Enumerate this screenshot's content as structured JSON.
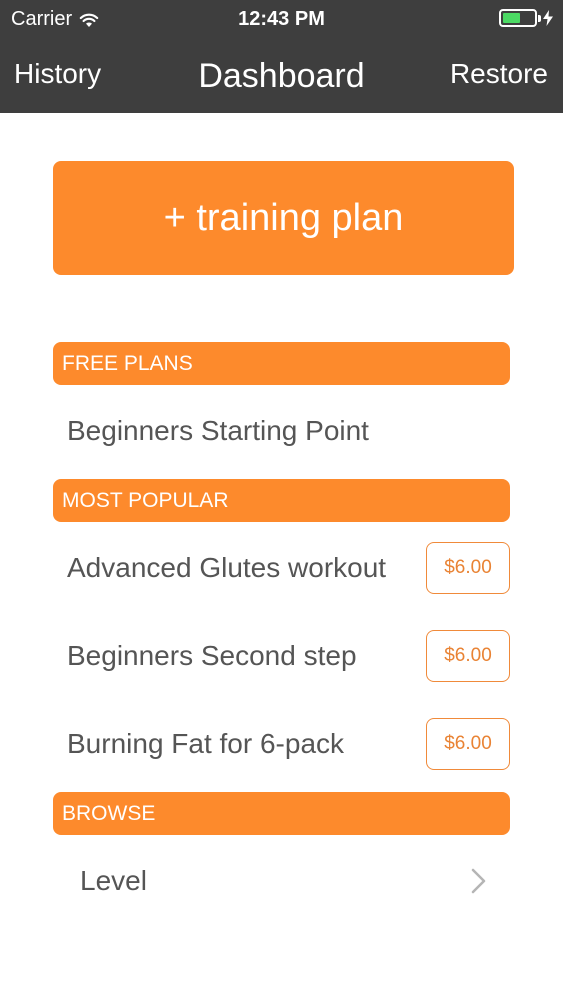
{
  "status_bar": {
    "carrier": "Carrier",
    "time": "12:43 PM",
    "battery_level": 0.55
  },
  "nav": {
    "left": "History",
    "title": "Dashboard",
    "right": "Restore"
  },
  "main_button": "+ training plan",
  "sections": {
    "free": {
      "header": "FREE PLANS",
      "items": [
        "Beginners Starting Point"
      ]
    },
    "popular": {
      "header": "MOST POPULAR",
      "items": [
        {
          "label": "Advanced Glutes workout",
          "price": "$6.00"
        },
        {
          "label": "Beginners Second step",
          "price": "$6.00"
        },
        {
          "label": "Burning Fat for 6-pack",
          "price": "$6.00"
        }
      ]
    },
    "browse": {
      "header": "BROWSE",
      "items": [
        "Level"
      ]
    }
  },
  "colors": {
    "accent": "#fd8a2c",
    "bar": "#3e3e3e",
    "text": "#555555",
    "battery": "#4cd964"
  },
  "icons": [
    "wifi-icon",
    "charging-bolt-icon",
    "battery-icon",
    "chevron-right-icon"
  ]
}
